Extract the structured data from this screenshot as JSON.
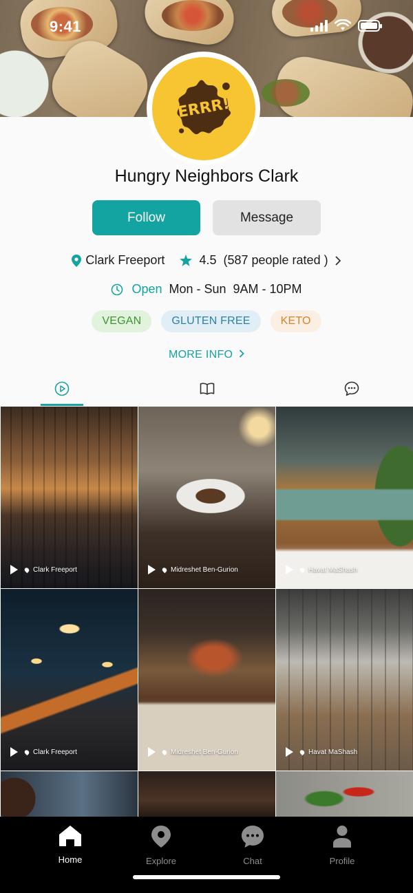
{
  "status_bar": {
    "time": "9:41"
  },
  "profile": {
    "name": "Hungry Neighbors Clark",
    "logo_text": "ERRR!",
    "location": "Clark Freeport",
    "rating": "4.5",
    "rating_count": "(587 people rated )",
    "open_label": "Open",
    "hours": "Mon - Sun  9AM - 10PM",
    "tags": [
      {
        "label": "VEGAN",
        "color": "#3c9433"
      },
      {
        "label": "GLUTEN FREE",
        "color": "#2c80a8"
      },
      {
        "label": "KETO",
        "color": "#d5832f"
      }
    ],
    "more_info": "MORE INFO"
  },
  "actions": {
    "follow_label": "Follow",
    "message_label": "Message"
  },
  "tabs": [
    {
      "icon": "play-circle-icon",
      "active": true
    },
    {
      "icon": "book-icon",
      "active": false
    },
    {
      "icon": "chat-bubble-icon",
      "active": false
    }
  ],
  "posts": [
    {
      "location": "Clark Freeport",
      "scene": "restaurant-interior"
    },
    {
      "location": "Midreshet Ben-Gurion",
      "scene": "plated-dish"
    },
    {
      "location": "Havat MaShash",
      "scene": "terrace-plants"
    },
    {
      "location": "Clark Freeport",
      "scene": "dark-dining-room"
    },
    {
      "location": "Midreshet Ben-Gurion",
      "scene": "bar-interior"
    },
    {
      "location": "Havat MaShash",
      "scene": "industrial-cafe"
    }
  ],
  "bottom_nav": [
    {
      "label": "Home",
      "icon": "home-icon",
      "active": true
    },
    {
      "label": "Explore",
      "icon": "map-pin-icon",
      "active": false
    },
    {
      "label": "Chat",
      "icon": "chat-icon",
      "active": false
    },
    {
      "label": "Profile",
      "icon": "person-icon",
      "active": false
    }
  ],
  "colors": {
    "accent": "#13a3a0",
    "logo_bg": "#f7c531"
  }
}
